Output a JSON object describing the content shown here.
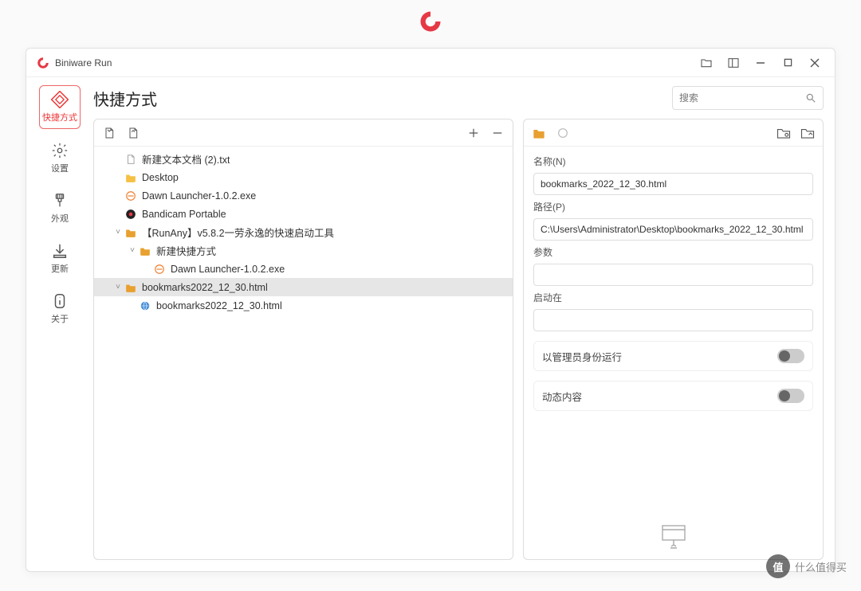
{
  "app": {
    "title": "Biniware Run"
  },
  "sidebar": {
    "items": [
      {
        "label": "快捷方式"
      },
      {
        "label": "设置"
      },
      {
        "label": "外观"
      },
      {
        "label": "更新"
      },
      {
        "label": "关于"
      }
    ]
  },
  "page": {
    "title": "快捷方式"
  },
  "search": {
    "placeholder": "搜索"
  },
  "tree": {
    "items": [
      {
        "label": "新建文本文档 (2).txt",
        "icon": "file",
        "indent": 0
      },
      {
        "label": "Desktop",
        "icon": "folder",
        "indent": 0
      },
      {
        "label": "Dawn Launcher-1.0.2.exe",
        "icon": "app-orange",
        "indent": 0
      },
      {
        "label": "Bandicam Portable",
        "icon": "bandicam",
        "indent": 0
      },
      {
        "label": "【RunAny】v5.8.2一劳永逸的快速启动工具",
        "icon": "folder2",
        "indent": 0,
        "expander": "˅"
      },
      {
        "label": "新建快捷方式",
        "icon": "folder2",
        "indent": 1,
        "expander": "˅"
      },
      {
        "label": "Dawn Launcher-1.0.2.exe",
        "icon": "app-orange",
        "indent": 2
      },
      {
        "label": "bookmarks2022_12_30.html",
        "icon": "folder2",
        "indent": 0,
        "selected": true,
        "expander": "˅"
      },
      {
        "label": "bookmarks2022_12_30.html",
        "icon": "html",
        "indent": 1
      }
    ]
  },
  "form": {
    "name_label": "名称(N)",
    "name_value": "bookmarks_2022_12_30.html",
    "path_label": "路径(P)",
    "path_value": "C:\\Users\\Administrator\\Desktop\\bookmarks_2022_12_30.html",
    "params_label": "参数",
    "params_value": "",
    "startin_label": "启动在",
    "startin_value": "",
    "admin_label": "以管理员身份运行",
    "dynamic_label": "动态内容"
  },
  "watermark": {
    "text": "什么值得买",
    "badge": "值"
  }
}
